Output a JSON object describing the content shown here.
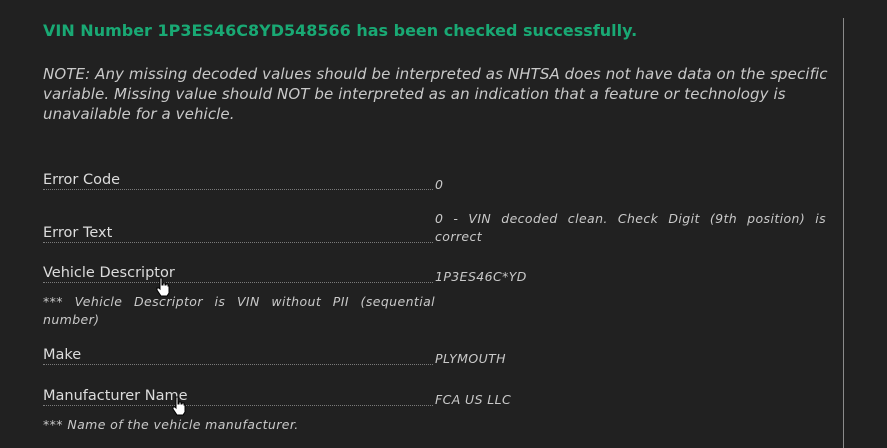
{
  "headline": "VIN Number 1P3ES46C8YD548566 has been checked successfully.",
  "note": "NOTE: Any missing decoded values should be interpreted as NHTSA does not have data on the specific variable. Missing value should NOT be interpreted as an indication that a feature or technology is unavailable for a vehicle.",
  "fields": {
    "error_code": {
      "label": "Error Code",
      "value": "0"
    },
    "error_text": {
      "label": "Error Text",
      "value": "0 - VIN decoded clean. Check Digit (9th position) is correct"
    },
    "vehicle_descriptor": {
      "label": "Vehicle Descriptor",
      "value": "1P3ES46C*YD",
      "hint": "*** Vehicle Descriptor is VIN without PII (sequential number)"
    },
    "make": {
      "label": "Make",
      "value": "PLYMOUTH"
    },
    "manufacturer_name": {
      "label": "Manufacturer Name",
      "value": "FCA US LLC",
      "hint": "*** Name of the vehicle manufacturer."
    }
  },
  "colors": {
    "background": "#212121",
    "accent_green": "#19a974",
    "text": "#c9c9c9"
  },
  "icons": [
    "hand-pointer-cursor-icon"
  ]
}
